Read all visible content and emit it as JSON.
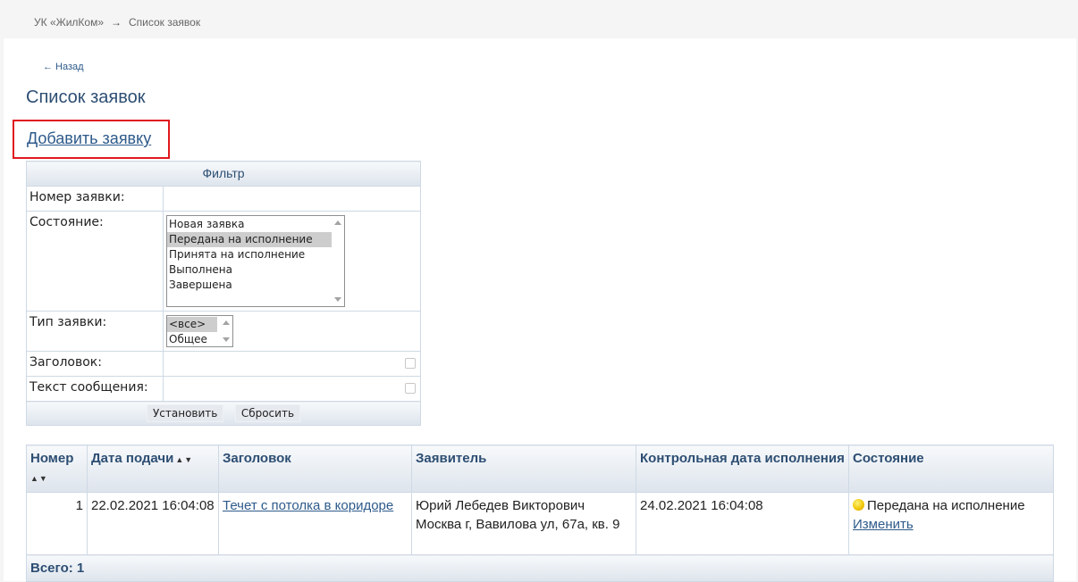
{
  "breadcrumb": {
    "org": "УК «ЖилКом»",
    "separator": "→",
    "current": "Список заявок"
  },
  "back_link": "← Назад",
  "page_title": "Список заявок",
  "add_link": "Добавить заявку",
  "highlight_color": "#e0191f",
  "filter": {
    "header": "Фильтр",
    "labels": {
      "number": "Номер заявки:",
      "state": "Состояние:",
      "type": "Тип заявки:",
      "title": "Заголовок:",
      "text": "Текст сообщения:"
    },
    "state_options": [
      "Новая заявка",
      "Передана на исполнение",
      "Принята на исполнение",
      "Выполнена",
      "Завершена"
    ],
    "state_selected": "Передана на исполнение",
    "type_options": [
      "<все>",
      "Общее"
    ],
    "type_selected": "<все>",
    "apply_button": "Установить",
    "reset_button": "Сбросить"
  },
  "table": {
    "columns": {
      "number": "Номер",
      "date": "Дата подачи",
      "title": "Заголовок",
      "applicant": "Заявитель",
      "deadline": "Контрольная дата исполнения",
      "state": "Состояние"
    },
    "sort_arrows": "▲▼",
    "rows": [
      {
        "number": "1",
        "date": "22.02.2021 16:04:08",
        "title": "Течет с потолка в коридоре",
        "applicant_name": "Юрий Лебедев Викторович",
        "applicant_address": "Москва г, Вавилова ул, 67а, кв. 9",
        "deadline": "24.02.2021 16:04:08",
        "state": "Передана на исполнение",
        "state_color": "#f0c400",
        "edit_link": "Изменить"
      }
    ],
    "total": "Всего: 1"
  }
}
